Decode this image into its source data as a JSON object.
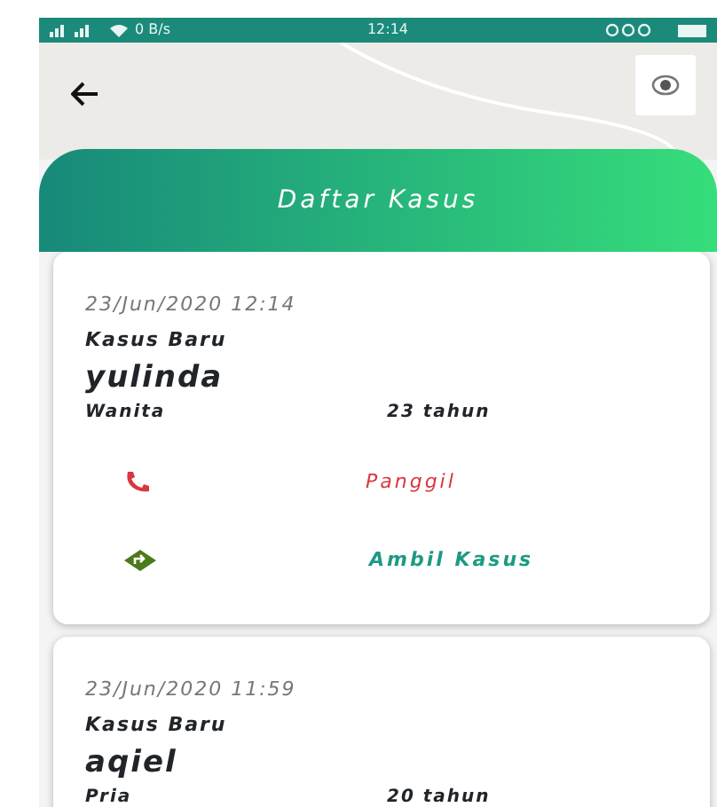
{
  "status_bar": {
    "speed": "0 B/s",
    "time": "12:14"
  },
  "header": {
    "title": "Daftar Kasus"
  },
  "cases": [
    {
      "date": "23/Jun/2020 12:14",
      "status": "Kasus Baru",
      "name": "yulinda",
      "gender": "Wanita",
      "age": "23 tahun",
      "actions": [
        {
          "kind": "call",
          "label": "Panggil"
        },
        {
          "kind": "take",
          "label": "Ambil Kasus"
        }
      ]
    },
    {
      "date": "23/Jun/2020 11:59",
      "status": "Kasus Baru",
      "name": "aqiel",
      "gender": "Pria",
      "age": "20 tahun"
    }
  ]
}
